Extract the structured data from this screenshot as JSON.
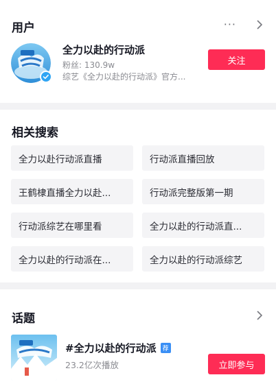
{
  "users_section": {
    "title": "用户",
    "more_label": "···",
    "user": {
      "name": "全力以赴的行动派",
      "fans": "粉丝: 130.9w",
      "desc": "综艺《全力以赴的行动派》官方...",
      "follow_label": "关注"
    }
  },
  "related_section": {
    "title": "相关搜索",
    "items": [
      "全力以赴行动派直播",
      "行动派直播回放",
      "王鹤棣直播全力以赴...",
      "行动派完整版第一期",
      "行动派综艺在哪里看",
      "全力以赴的行动派直...",
      "全力以赴的行动派在...",
      "全力以赴的行动派综艺"
    ]
  },
  "topics_section": {
    "title": "话题",
    "topic": {
      "name": "#全力以赴的行动派",
      "badge": "荐",
      "plays": "23.2亿次播放",
      "join_label": "立即参与"
    }
  },
  "colors": {
    "accent": "#fe2c55",
    "badge_blue": "#3a8ff5",
    "verified_blue": "#2fa5f4"
  },
  "icons": [
    "more-dots-icon",
    "chevron-right-icon",
    "verified-check-icon"
  ]
}
